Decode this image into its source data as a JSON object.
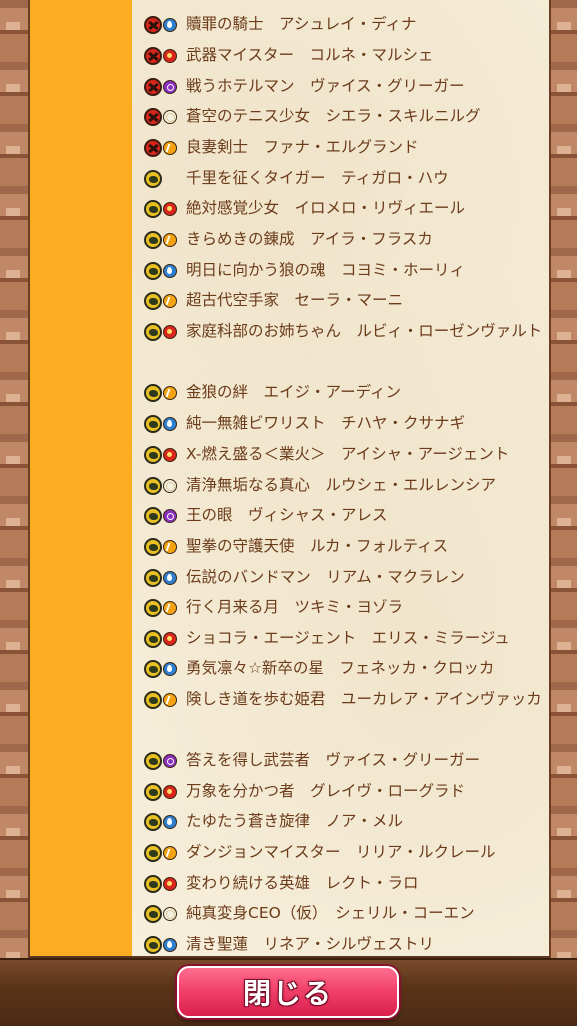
{
  "entries": [
    {
      "text": "贖罪の騎士　アシュレイ・ディナ",
      "icon1": "red",
      "icon2": "blue"
    },
    {
      "text": "武器マイスター　コルネ・マルシェ",
      "icon1": "red",
      "icon2": "red"
    },
    {
      "text": "戦うホテルマン　ヴァイス・グリーガー",
      "icon1": "red",
      "icon2": "purple"
    },
    {
      "text": "蒼空のテニス少女　シエラ・スキルニルグ",
      "icon1": "red",
      "icon2": "white"
    },
    {
      "text": "良妻剣士　ファナ・エルグランド",
      "icon1": "red",
      "icon2": "orange"
    },
    {
      "text": "千里を征くタイガー　ティガロ・ハウ",
      "icon1": "yellow",
      "icon2": ""
    },
    {
      "text": "絶対感覚少女　イロメロ・リヴィエール",
      "icon1": "yellow",
      "icon2": "red"
    },
    {
      "text": "きらめきの錬成　アイラ・フラスカ",
      "icon1": "yellow",
      "icon2": "orange"
    },
    {
      "text": "明日に向かう狼の魂　コヨミ・ホーリィ",
      "icon1": "yellow",
      "icon2": "blue"
    },
    {
      "text": "超古代空手家　セーラ・マーニ",
      "icon1": "yellow",
      "icon2": "orange"
    },
    {
      "text": "家庭科部のお姉ちゃん　ルビィ・ローゼンヴァルト",
      "icon1": "yellow",
      "icon2": "red"
    },
    {
      "text": "金狼の絆　エイジ・アーディン",
      "icon1": "yellow",
      "icon2": "orange"
    },
    {
      "text": "純一無雑ビワリスト　チハヤ・クサナギ",
      "icon1": "yellow",
      "icon2": "blue"
    },
    {
      "text": "X-燃え盛る＜業火＞　アイシャ・アージェント",
      "icon1": "yellow",
      "icon2": "red"
    },
    {
      "text": "清浄無垢なる真心　ルウシェ・エルレンシア",
      "icon1": "yellow",
      "icon2": "white"
    },
    {
      "text": "王の眼　ヴィシャス・アレス",
      "icon1": "yellow",
      "icon2": "purple"
    },
    {
      "text": "聖拳の守護天使　ルカ・フォルティス",
      "icon1": "yellow",
      "icon2": "orange"
    },
    {
      "text": "伝説のバンドマン　リアム・マクラレン",
      "icon1": "yellow",
      "icon2": "blue"
    },
    {
      "text": "行く月来る月　ツキミ・ヨゾラ",
      "icon1": "yellow",
      "icon2": "orange"
    },
    {
      "text": "ショコラ・エージェント　エリス・ミラージュ",
      "icon1": "yellow",
      "icon2": "red"
    },
    {
      "text": "勇気凛々☆新卒の星　フェネッカ・クロッカ",
      "icon1": "yellow",
      "icon2": "blue"
    },
    {
      "text": "険しき道を歩む姫君　ユーカレア・アインヴァッカ",
      "icon1": "yellow",
      "icon2": "orange"
    },
    {
      "text": "答えを得し武芸者　ヴァイス・グリーガー",
      "icon1": "yellow",
      "icon2": "purple"
    },
    {
      "text": "万象を分かつ者　グレイヴ・ローグラド",
      "icon1": "yellow",
      "icon2": "red"
    },
    {
      "text": "たゆたう蒼き旋律　ノア・メル",
      "icon1": "yellow",
      "icon2": "blue"
    },
    {
      "text": "ダンジョンマイスター　リリア・ルクレール",
      "icon1": "yellow",
      "icon2": "orange"
    },
    {
      "text": "変わり続ける英雄　レクト・ラロ",
      "icon1": "yellow",
      "icon2": "red"
    },
    {
      "text": "純真変身CEO（仮）　シェリル・コーエン",
      "icon1": "yellow",
      "icon2": "white"
    },
    {
      "text": "清き聖蓮　リネア・シルヴェストリ",
      "icon1": "yellow",
      "icon2": "blue"
    }
  ],
  "footer": {
    "close_label": "閉じる"
  }
}
